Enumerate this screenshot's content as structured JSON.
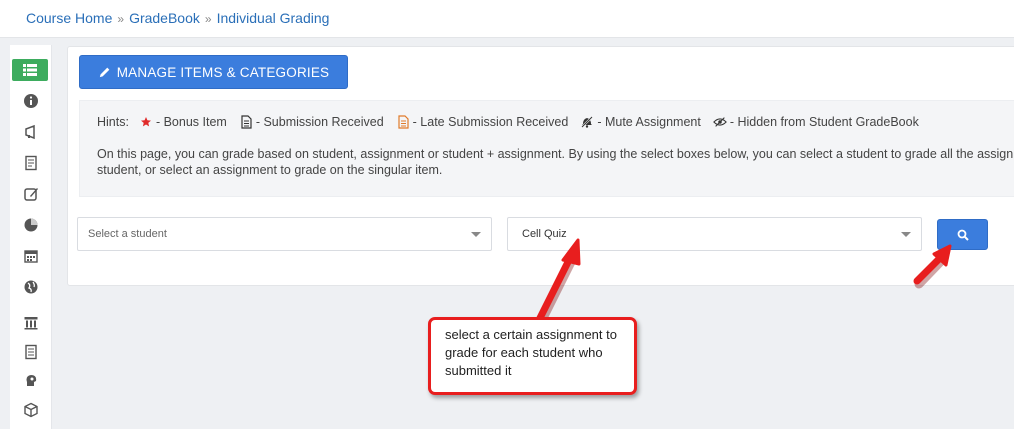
{
  "breadcrumb": [
    {
      "label": "Course Home"
    },
    {
      "label": "GradeBook"
    },
    {
      "label": "Individual Grading"
    }
  ],
  "breadcrumb_separator": "»",
  "sidebar": {
    "items": [
      {
        "icon": "list-icon",
        "active": true
      },
      {
        "icon": "info-icon"
      },
      {
        "icon": "megaphone-icon"
      },
      {
        "icon": "document-icon"
      },
      {
        "icon": "edit-icon"
      },
      {
        "icon": "pie-chart-icon"
      },
      {
        "icon": "calendar-icon"
      },
      {
        "icon": "globe-icon"
      },
      {
        "icon": "archive-icon"
      },
      {
        "icon": "notes-icon"
      },
      {
        "icon": "head-icon"
      },
      {
        "icon": "cube-icon"
      }
    ],
    "active_color": "#3dac5e"
  },
  "toolbar": {
    "manage_label": "MANAGE ITEMS & CATEGORIES",
    "accent_color": "#3b7ddd"
  },
  "hints": {
    "label": "Hints:",
    "items": [
      {
        "icon": "star-icon",
        "text": "- Bonus Item",
        "color": "#e02b2b"
      },
      {
        "icon": "submission-icon",
        "text": "- Submission Received"
      },
      {
        "icon": "late-submission-icon",
        "text": "- Late Submission Received",
        "color": "#e07b2b"
      },
      {
        "icon": "mute-icon",
        "text": "- Mute Assignment"
      },
      {
        "icon": "hidden-eye-icon",
        "text": "- Hidden from Student GradeBook"
      }
    ],
    "description": "On this page, you can grade based on student, assignment or student + assignment. By using the select boxes below, you can select a student to grade all the assignments of that student, or select an assignment to grade on the singular item."
  },
  "filters": {
    "student_placeholder": "Select a student",
    "assignment_value": "Cell Quiz"
  },
  "annotation": {
    "text": "select a certain assignment to grade for each student who submitted it",
    "border_color": "#e81e1e"
  }
}
